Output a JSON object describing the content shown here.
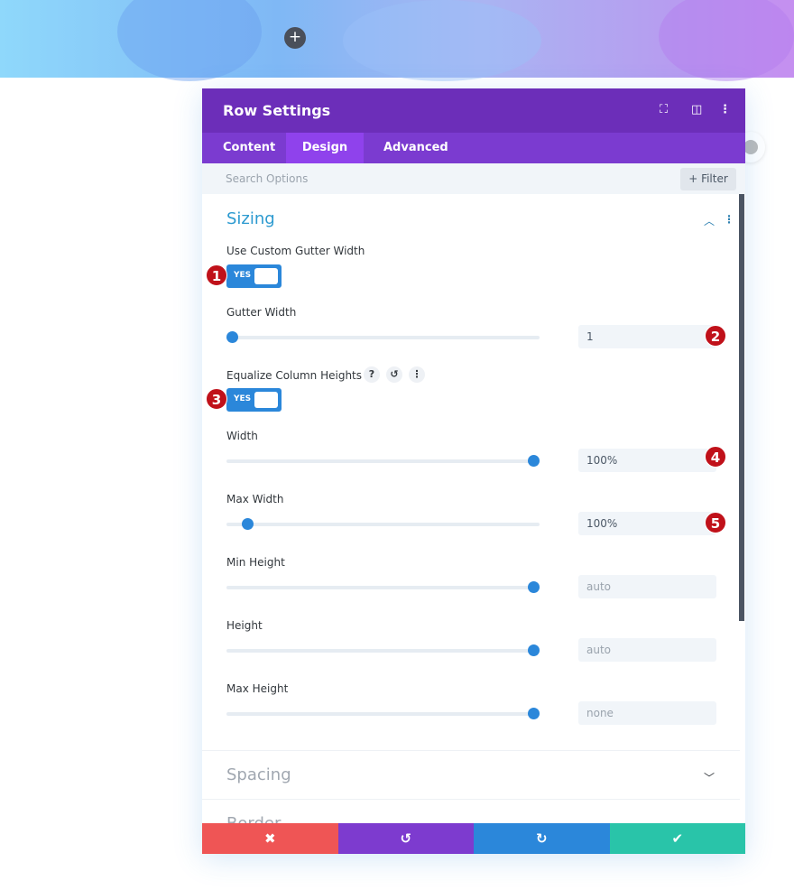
{
  "header": {
    "title": "Row Settings",
    "icons": [
      "fullscreen-icon",
      "split-view-icon",
      "more-vertical-icon"
    ]
  },
  "tabs": [
    {
      "label": "Content"
    },
    {
      "label": "Design",
      "active": true
    },
    {
      "label": "Advanced"
    }
  ],
  "search": {
    "placeholder": "Search Options",
    "filter_label": "+ Filter"
  },
  "section": {
    "title": "Sizing"
  },
  "fields": {
    "custom_gutter": {
      "label": "Use Custom Gutter Width",
      "toggle": "YES",
      "badge": "1"
    },
    "gutter_width": {
      "label": "Gutter Width",
      "value": "1",
      "slider_fraction": 0,
      "badge": "2"
    },
    "equalize": {
      "label": "Equalize Column Heights",
      "toggle": "YES",
      "badge": "3",
      "help": "?",
      "reset": "↺",
      "more": "⋮"
    },
    "width": {
      "label": "Width",
      "value": "100%",
      "slider_fraction": 1,
      "badge": "4"
    },
    "max_width": {
      "label": "Max Width",
      "value": "100%",
      "slider_fraction": 0.05,
      "badge": "5"
    },
    "min_height": {
      "label": "Min Height",
      "placeholder": "auto",
      "slider_fraction": 1
    },
    "height": {
      "label": "Height",
      "placeholder": "auto",
      "slider_fraction": 1
    },
    "max_height": {
      "label": "Max Height",
      "placeholder": "none",
      "slider_fraction": 1
    }
  },
  "collapsed": [
    {
      "title": "Spacing"
    },
    {
      "title": "Border"
    }
  ],
  "footer": {
    "cancel": "✖",
    "undo": "↺",
    "redo": "↻",
    "save": "✔"
  },
  "colors": {
    "header": "#6c2eb9",
    "tabs": "#7b3bd0",
    "accent": "#2b87da",
    "cancel": "#ef5555",
    "undo": "#7d3bcf",
    "redo": "#2b87da",
    "save": "#29c4a9",
    "badge": "#c0111a"
  }
}
